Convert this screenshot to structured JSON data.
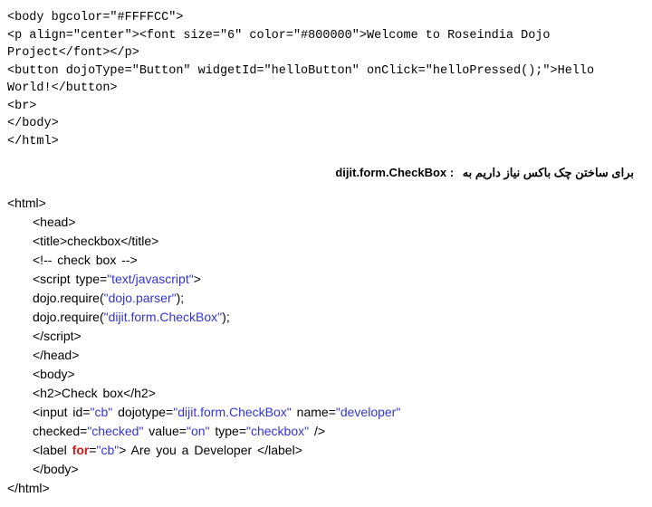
{
  "block1": {
    "l1": "<body bgcolor=\"#FFFFCC\">",
    "l2": "<p align=\"center\"><font size=\"6\" color=\"#800000\">Welcome to Roseindia Dojo Project</font></p>",
    "l3": "<button dojoType=\"Button\" widgetId=\"helloButton\" onClick=\"helloPressed();\">Hello World!</button>",
    "l4": "<br>",
    "l5": "</body>",
    "l6": "</html>"
  },
  "heading": {
    "persian": "برای ساختن چک باکس نیاز داریم به",
    "latin": "dijit.form.CheckBox"
  },
  "block2": {
    "l1": "<html>",
    "l2": "<head>",
    "l3": "<title>checkbox</title>",
    "l4": "<!-- check box -->",
    "l5a": "<script type=",
    "l5b": "\"text/javascript\"",
    "l5c": ">",
    "l6a": "dojo.require(",
    "l6b": "\"dojo.parser\"",
    "l6c": ");",
    "l7a": "dojo.require(",
    "l7b": "\"dijit.form.CheckBox\"",
    "l7c": ");",
    "l8a": "<",
    "l8b": "/script",
    "l8c": ">",
    "l9": "</head>",
    "l10": "<body>",
    "l11": "<h2>Check box</h2>",
    "l12a": "<input id=",
    "l12b": "\"cb\"",
    "l12c": " dojotype=",
    "l12d": "\"dijit.form.CheckBox\"",
    "l12e": " name=",
    "l12f": "\"developer\"",
    "l13a": " checked=",
    "l13b": "\"checked\"",
    "l13c": " value=",
    "l13d": "\"on\"",
    "l13e": " type=",
    "l13f": "\"checkbox\"",
    "l13g": " />",
    "l14a": "<label ",
    "l14b": "for",
    "l14c": "=",
    "l14d": "\"cb\"",
    "l14e": "> Are you a Developer </label>",
    "l15": "</body>",
    "l16": "</html>"
  }
}
